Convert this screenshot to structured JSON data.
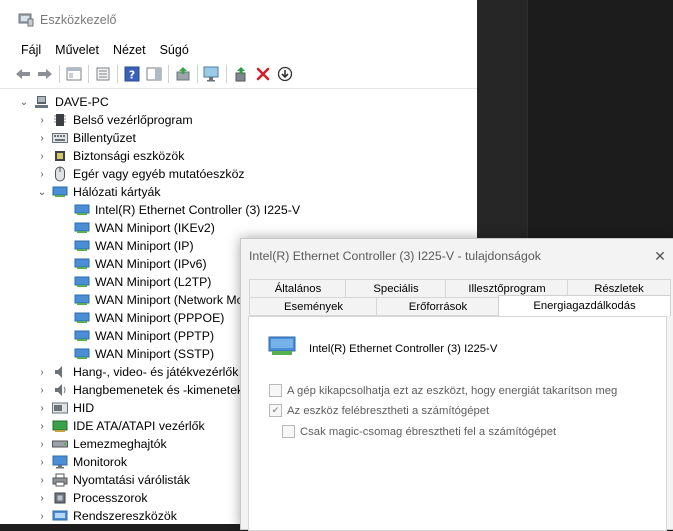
{
  "window": {
    "title": "Eszközkezelő"
  },
  "menu": [
    "Fájl",
    "Művelet",
    "Nézet",
    "Súgó"
  ],
  "toolbar_icons": [
    "back-arrow-icon",
    "forward-arrow-icon",
    "show-hide-tree-icon",
    "properties-icon",
    "help-icon",
    "action-pane-icon",
    "update-driver-icon",
    "scan-hardware-icon",
    "enable-device-icon",
    "uninstall-icon",
    "download-icon"
  ],
  "tree": {
    "root": "DAVE-PC",
    "categories": [
      {
        "label": "Belső vezérlőprogram",
        "icon": "firmware-icon",
        "expanded": false
      },
      {
        "label": "Billentyűzet",
        "icon": "keyboard-icon",
        "expanded": false
      },
      {
        "label": "Biztonsági eszközök",
        "icon": "security-icon",
        "expanded": false
      },
      {
        "label": "Egér vagy egyéb mutatóeszköz",
        "icon": "mouse-icon",
        "expanded": false
      },
      {
        "label": "Hálózati kártyák",
        "icon": "network-icon",
        "expanded": true,
        "children": [
          "Intel(R) Ethernet Controller (3) I225-V",
          "WAN Miniport (IKEv2)",
          "WAN Miniport (IP)",
          "WAN Miniport (IPv6)",
          "WAN Miniport (L2TP)",
          "WAN Miniport (Network Mo",
          "WAN Miniport (PPPOE)",
          "WAN Miniport (PPTP)",
          "WAN Miniport (SSTP)"
        ]
      },
      {
        "label": "Hang-, video- és játékvezérlők",
        "icon": "audio-icon",
        "expanded": false
      },
      {
        "label": "Hangbemenetek és -kimenetek",
        "icon": "speaker-icon",
        "expanded": false
      },
      {
        "label": "HID",
        "icon": "hid-icon",
        "expanded": false
      },
      {
        "label": "IDE ATA/ATAPI vezérlők",
        "icon": "ide-icon",
        "expanded": false
      },
      {
        "label": "Lemezmeghajtók",
        "icon": "disk-icon",
        "expanded": false
      },
      {
        "label": "Monitorok",
        "icon": "monitor-icon",
        "expanded": false
      },
      {
        "label": "Nyomtatási várólisták",
        "icon": "printer-icon",
        "expanded": false
      },
      {
        "label": "Processzorok",
        "icon": "cpu-icon",
        "expanded": false
      },
      {
        "label": "Rendszereszközök",
        "icon": "system-icon",
        "expanded": false
      }
    ]
  },
  "dialog": {
    "title": "Intel(R) Ethernet Controller (3) I225-V - tulajdonságok",
    "tabs_row1": [
      "Általános",
      "Speciális",
      "Illesztőprogram",
      "Részletek"
    ],
    "tabs_row2": [
      "Események",
      "Erőforrások",
      "Energiagazdálkodás"
    ],
    "active_tab": "Energiagazdálkodás",
    "device_name": "Intel(R) Ethernet Controller (3) I225-V",
    "options": [
      {
        "label": "A gép kikapcsolhatja ezt az eszközt, hogy energiát takarítson meg",
        "checked": false,
        "enabled": false
      },
      {
        "label": "Az eszköz felébresztheti a számítógépet",
        "checked": true,
        "enabled": false
      },
      {
        "label": "Csak magic-csomag ébresztheti fel a számítógépet",
        "checked": false,
        "enabled": false
      }
    ]
  }
}
